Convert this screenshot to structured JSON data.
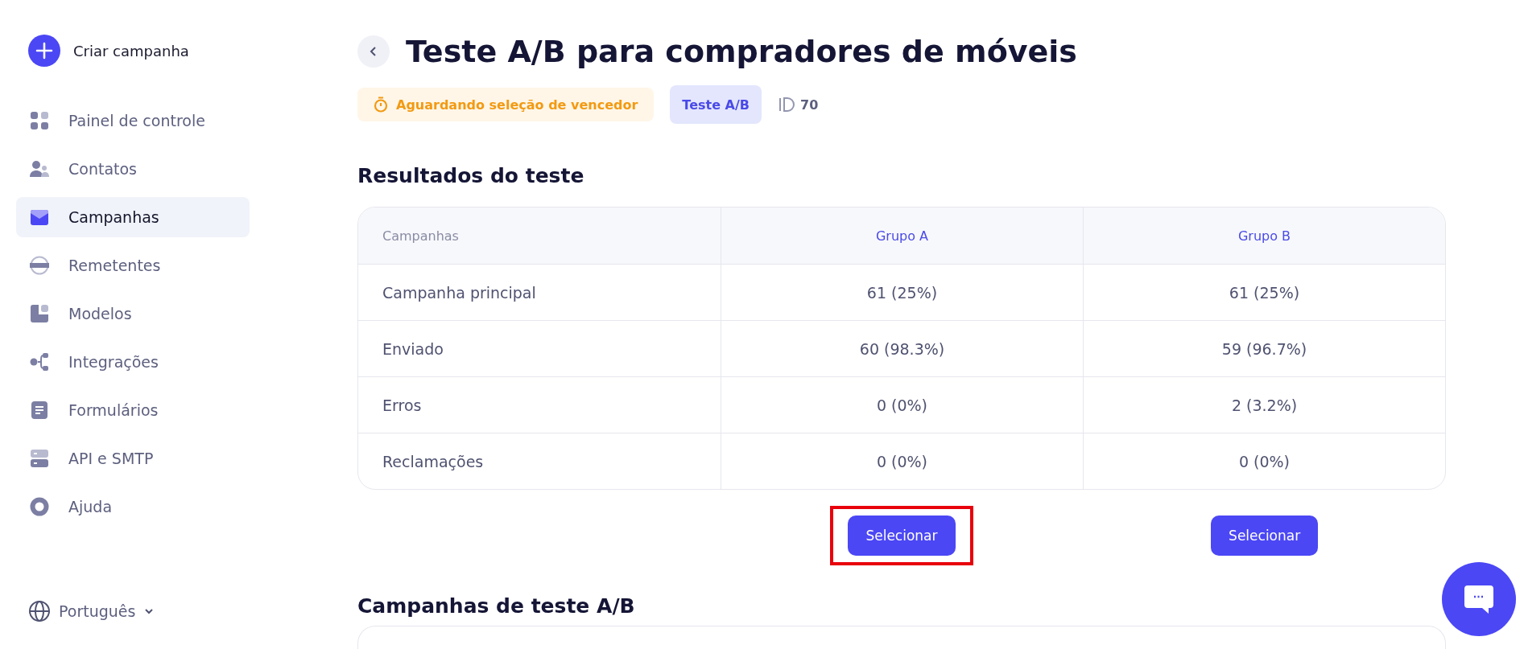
{
  "sidebar": {
    "create_button": {
      "label": "Criar campanha"
    },
    "items": [
      {
        "label": "Painel de controle",
        "selected": false
      },
      {
        "label": "Contatos",
        "selected": false
      },
      {
        "label": "Campanhas",
        "selected": true
      },
      {
        "label": "Remetentes",
        "selected": false
      },
      {
        "label": "Modelos",
        "selected": false
      },
      {
        "label": "Integrações",
        "selected": false
      },
      {
        "label": "Formulários",
        "selected": false
      },
      {
        "label": "API e SMTP",
        "selected": false
      },
      {
        "label": "Ajuda",
        "selected": false
      }
    ],
    "language": {
      "label": "Português"
    }
  },
  "header": {
    "title": "Teste A/B para compradores de móveis",
    "status": "Aguardando seleção de vencedor",
    "type_badge": "Teste A/B",
    "id": "70"
  },
  "results": {
    "title": "Resultados do teste",
    "table": {
      "columns": [
        "Campanhas",
        "Grupo A",
        "Grupo B"
      ],
      "rows": [
        [
          "Campanha principal",
          "61 (25%)",
          "61 (25%)"
        ],
        [
          "Enviado",
          "60 (98.3%)",
          "59 (96.7%)"
        ],
        [
          "Erros",
          "0 (0%)",
          "2 (3.2%)"
        ],
        [
          "Reclamações",
          "0 (0%)",
          "0 (0%)"
        ]
      ]
    },
    "select_buttons": [
      {
        "label": "Selecionar",
        "highlighted": true
      },
      {
        "label": "Selecionar",
        "highlighted": false
      }
    ]
  },
  "ab_campaigns": {
    "title": "Campanhas de teste A/B"
  }
}
